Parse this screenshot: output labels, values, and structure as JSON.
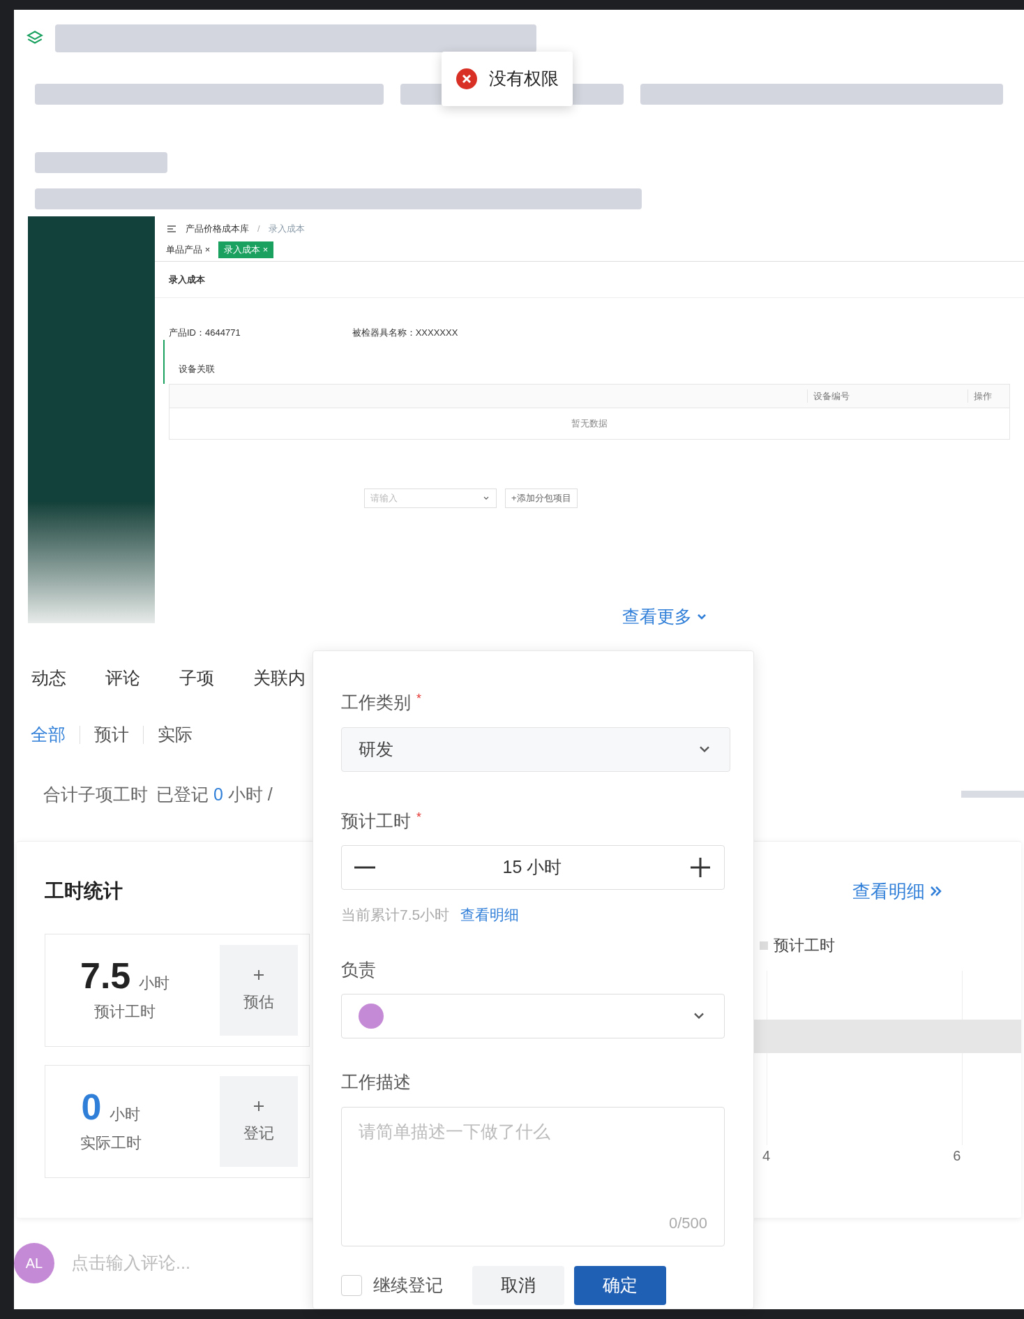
{
  "toast": {
    "text": "没有权限"
  },
  "embedded_screenshot": {
    "breadcrumb": [
      "产品价格成本库",
      "录入成本"
    ],
    "breadcrumb_separator": "/",
    "tabs": [
      {
        "label": "单品产品",
        "close": "×",
        "selected": false
      },
      {
        "label": "录入成本",
        "close": "×",
        "selected": true
      }
    ],
    "heading": "录入成本",
    "fields": [
      "产品ID：4644771",
      "被检器具名称：XXXXXXX"
    ],
    "section": "设备关联",
    "columns": [
      "设备编号",
      "操作"
    ],
    "empty": "暂无数据",
    "input_placeholder": "请输入",
    "add_button": "+添加分包项目"
  },
  "view_more": "查看更多",
  "tabs": [
    "动态",
    "评论",
    "子项",
    "关联内"
  ],
  "filters": [
    {
      "label": "全部",
      "selected": true
    },
    {
      "label": "预计",
      "selected": false
    },
    {
      "label": "实际",
      "selected": false
    }
  ],
  "summary": {
    "label": "合计子项工时",
    "registered_label": "已登记",
    "registered_value": "0",
    "unit": "小时 /"
  },
  "stats": {
    "title": "工时统计",
    "link": "查看明细",
    "items": [
      {
        "kind": "estimate",
        "value": "7.5",
        "unit": "小时",
        "label": "预计工时",
        "action": "预估"
      },
      {
        "kind": "actual",
        "value": "0",
        "unit": "小时",
        "label": "实际工时",
        "action": "登记"
      }
    ]
  },
  "chart": {
    "legend": "预计工时",
    "ticks": [
      "4",
      "6"
    ]
  },
  "dialog": {
    "category": {
      "label": "工作类别",
      "required_mark": "*",
      "value": "研发"
    },
    "hours": {
      "label": "预计工时",
      "required_mark": "*",
      "value": "15 小时",
      "hint": "当前累计7.5小时",
      "hint_link": "查看明细"
    },
    "owner": {
      "label": "负责"
    },
    "description": {
      "label": "工作描述",
      "placeholder": "请简单描述一下做了什么",
      "counter": "0/500"
    },
    "continue": {
      "label": "继续登记",
      "checked": false
    },
    "buttons": [
      "取消",
      "确定"
    ]
  },
  "comment": {
    "avatar": "AL",
    "placeholder": "点击输入评论..."
  }
}
